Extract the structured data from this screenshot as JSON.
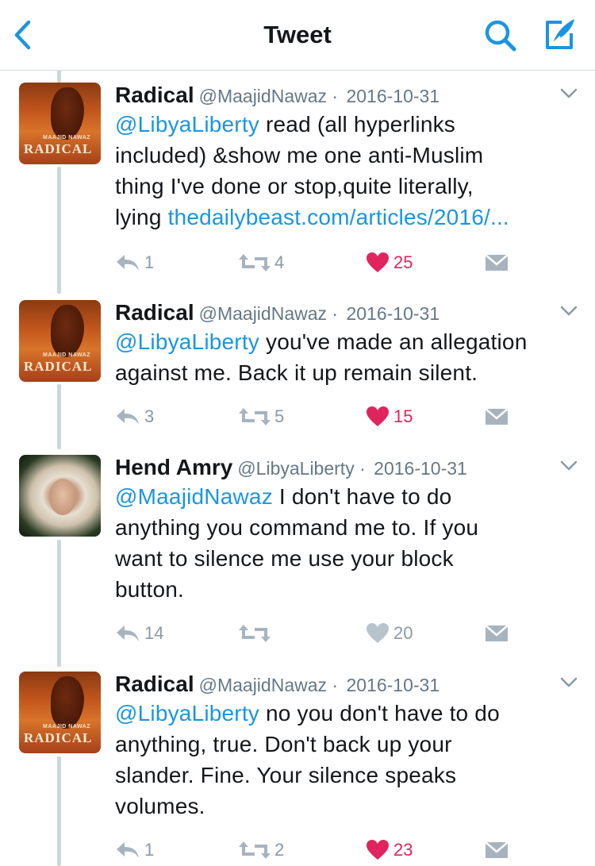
{
  "nav": {
    "title": "Tweet"
  },
  "tweets": [
    {
      "name": "Radical",
      "handle": "@MaajidNawaz",
      "date": "2016-10-31",
      "avatar": {
        "type": "book",
        "author": "MAAJID NAWAZ",
        "title": "RADICAL"
      },
      "mention": "@LibyaLiberty",
      "lines": [
        "read (all hyperlinks",
        "included) &show me one anti-Muslim",
        "thing I've done or stop,quite literally,",
        "lying"
      ],
      "url": "thedailybeast.com/articles/2016/...",
      "replies": "1",
      "retweets": "4",
      "likes": "25",
      "liked": true
    },
    {
      "name": "Radical",
      "handle": "@MaajidNawaz",
      "date": "2016-10-31",
      "avatar": {
        "type": "book",
        "author": "MAAJID NAWAZ",
        "title": "RADICAL"
      },
      "mention": "@LibyaLiberty",
      "lines": [
        "you've made an allegation",
        "against me. Back it up remain silent."
      ],
      "replies": "3",
      "retweets": "5",
      "likes": "15",
      "liked": true
    },
    {
      "name": "Hend Amry",
      "handle": "@LibyaLiberty",
      "date": "2016-10-31",
      "avatar": {
        "type": "photo"
      },
      "mention": "@MaajidNawaz",
      "lines": [
        "I don't have to do",
        "anything you command me to. If you",
        "want to silence me use your block",
        "button."
      ],
      "replies": "14",
      "retweets": "",
      "likes": "20",
      "liked": false
    },
    {
      "name": "Radical",
      "handle": "@MaajidNawaz",
      "date": "2016-10-31",
      "avatar": {
        "type": "book",
        "author": "MAAJID NAWAZ",
        "title": "RADICAL"
      },
      "mention": "@LibyaLiberty",
      "lines": [
        "no you don't have to do",
        "anything, true. Don't back up your",
        "slander. Fine. Your silence speaks",
        "volumes."
      ],
      "replies": "1",
      "retweets": "2",
      "likes": "23",
      "liked": true
    }
  ],
  "colors": {
    "link": "#1b95e0",
    "like": "#e0245e",
    "muted": "#8899a6",
    "thread": "#ccd6dd"
  },
  "icons": [
    "back-chevron-icon",
    "search-icon",
    "compose-icon",
    "chevron-down-icon",
    "reply-icon",
    "retweet-icon",
    "heart-icon",
    "direct-message-icon"
  ]
}
